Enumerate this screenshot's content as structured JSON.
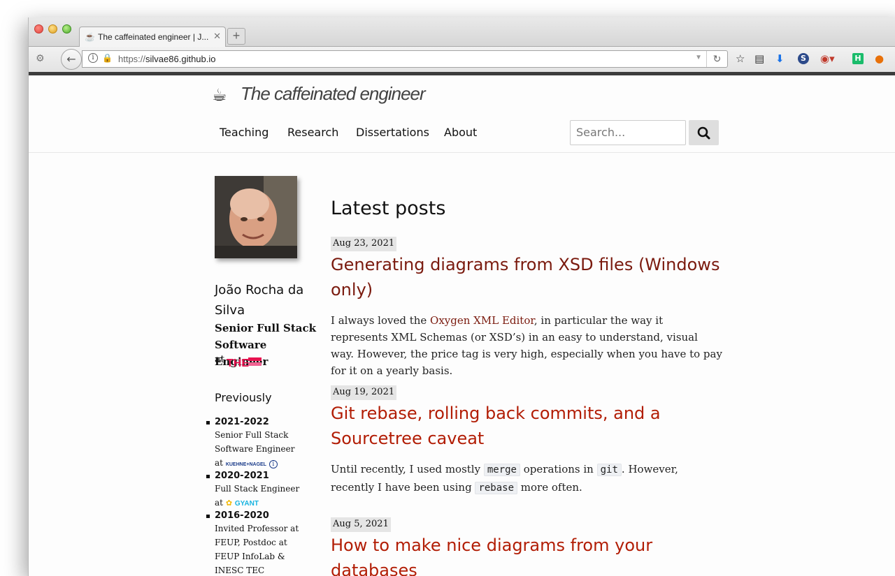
{
  "browser": {
    "tab_title": "The caffeinated engineer | J...",
    "tab_close": "✕",
    "new_tab": "+",
    "url_scheme": "https://",
    "url_host": "silvae86.github.io"
  },
  "site": {
    "title": "The caffeinated engineer",
    "nav": [
      "Teaching",
      "Research",
      "Dissertations",
      "About"
    ],
    "search_placeholder": "Search..."
  },
  "sidebar": {
    "name": "João Rocha da Silva",
    "role": "Senior Full Stack Software Engineer",
    "at": "at",
    "previously": "Previously",
    "history": [
      {
        "years": "2021-2022",
        "desc": "Senior Full Stack Software Engineer",
        "at": "at"
      },
      {
        "years": "2020-2021",
        "desc": "Full Stack Engineer",
        "at": "at"
      },
      {
        "years": "2016-2020",
        "desc": "Invited Professor at FEUP, Postdoc at FEUP InfoLab & INESC TEC"
      }
    ],
    "logos": {
      "the": "THE",
      "kn": "KUEHNE+NAGEL",
      "gyant": "GYANT"
    }
  },
  "main": {
    "heading": "Latest posts",
    "posts": [
      {
        "date": "Aug 23, 2021",
        "title": "Generating diagrams from XSD files (Windows only)",
        "excerpt_1": "I always loved the ",
        "excerpt_link": "Oxygen XML Editor",
        "excerpt_2": ", in particular the way it represents XML Schemas (or XSD’s) in an easy to understand, visual way. However, the price tag is very high, especially when you have to pay for it on a yearly basis."
      },
      {
        "date": "Aug 19, 2021",
        "title": "Git rebase, rolling back commits, and a Sourcetree caveat",
        "excerpt_1": "Until recently, I used mostly ",
        "code_1": "merge",
        "excerpt_2": " operations in ",
        "code_2": "git",
        "excerpt_3": ". However, recently I have been using ",
        "code_3": "rebase",
        "excerpt_4": " more often."
      },
      {
        "date": "Aug 5, 2021",
        "title": "How to make nice diagrams from your databases"
      }
    ]
  },
  "colors": {
    "link": "#b21d05",
    "visited": "#7a1a0e"
  }
}
